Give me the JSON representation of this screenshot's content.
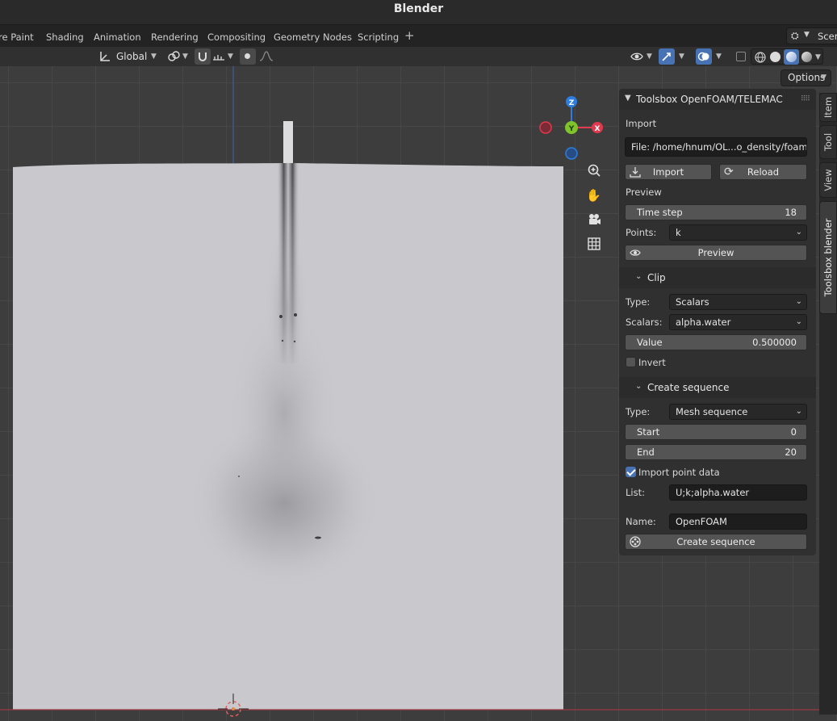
{
  "window": {
    "title": "Blender"
  },
  "workspace_tabs": [
    "re Paint",
    "Shading",
    "Animation",
    "Rendering",
    "Compositing",
    "Geometry Nodes",
    "Scripting"
  ],
  "add_workspace": "+",
  "scene": {
    "label": "Scen"
  },
  "viewport_header": {
    "orientation": "Global",
    "options_label": "Options"
  },
  "side_tabs": [
    "Item",
    "Tool",
    "View",
    "Toolsbox blender"
  ],
  "panel": {
    "title": "Toolsbox OpenFOAM/TELEMAC",
    "import": {
      "section": "Import",
      "file_value": "File: /home/hnum/OL...o_density/foam.foam",
      "import_label": "Import",
      "reload_label": "Reload"
    },
    "preview": {
      "section": "Preview",
      "time_step_label": "Time step",
      "time_step_value": "18",
      "points_label": "Points:",
      "points_value": "k",
      "preview_label": "Preview"
    },
    "clip": {
      "header": "Clip",
      "type_label": "Type:",
      "type_value": "Scalars",
      "scalars_label": "Scalars:",
      "scalars_value": "alpha.water",
      "value_label": "Value",
      "value_value": "0.500000",
      "invert_label": "Invert",
      "invert_checked": false
    },
    "sequence": {
      "header": "Create sequence",
      "type_label": "Type:",
      "type_value": "Mesh sequence",
      "start_label": "Start",
      "start_value": "0",
      "end_label": "End",
      "end_value": "20",
      "import_point_data_label": "Import point data",
      "import_point_data_checked": true,
      "list_label": "List:",
      "list_value": "U;k;alpha.water",
      "name_label": "Name:",
      "name_value": "OpenFOAM",
      "create_label": "Create sequence"
    }
  },
  "gizmo": {
    "z": "Z",
    "y": "Y",
    "x": "X"
  },
  "colors": {
    "accent": "#4772b3",
    "axis_x": "#e1394e",
    "axis_y": "#7ec42a",
    "axis_z": "#2d7ee0"
  }
}
